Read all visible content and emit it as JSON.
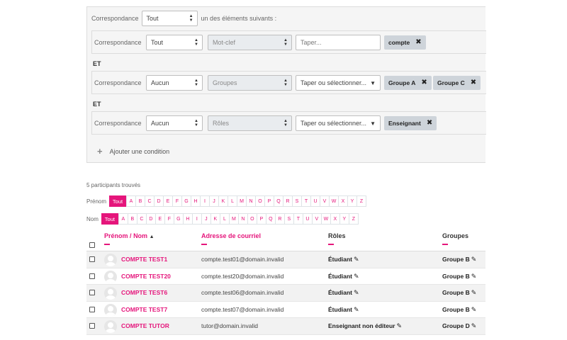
{
  "filters": {
    "match_label": "Correspondance",
    "match_value": "Tout",
    "match_suffix": "un des éléments suivants :",
    "conditions": [
      {
        "match_label": "Correspondance",
        "match_value": "Tout",
        "type": "Mot-clef",
        "input_placeholder": "Taper...",
        "tags": [
          "compte"
        ]
      },
      {
        "join": "ET",
        "match_label": "Correspondance",
        "match_value": "Aucun",
        "type": "Groupes",
        "input_placeholder": "Taper ou sélectionner...",
        "tags": [
          "Groupe A",
          "Groupe C"
        ]
      },
      {
        "join": "ET",
        "match_label": "Correspondance",
        "match_value": "Aucun",
        "type": "Rôles",
        "input_placeholder": "Taper ou sélectionner...",
        "tags": [
          "Enseignant"
        ]
      }
    ],
    "add_condition": "Ajouter une condition"
  },
  "participants": {
    "count_text": "5 participants trouvés",
    "firstname_label": "Prénom",
    "lastname_label": "Nom",
    "all_label": "Tout",
    "letters": [
      "A",
      "B",
      "C",
      "D",
      "E",
      "F",
      "G",
      "H",
      "I",
      "J",
      "K",
      "L",
      "M",
      "N",
      "O",
      "P",
      "Q",
      "R",
      "S",
      "T",
      "U",
      "V",
      "W",
      "X",
      "Y",
      "Z"
    ],
    "columns": {
      "firstname": "Prénom",
      "sep": "/",
      "lastname": "Nom",
      "email": "Adresse de courriel",
      "roles": "Rôles",
      "groups": "Groupes"
    },
    "rows": [
      {
        "name": "COMPTE TEST1",
        "email": "compte.test01@domain.invalid",
        "role": "Étudiant",
        "group": "Groupe B"
      },
      {
        "name": "COMPTE TEST20",
        "email": "compte.test20@domain.invalid",
        "role": "Étudiant",
        "group": "Groupe B"
      },
      {
        "name": "COMPTE TEST6",
        "email": "compte.test06@domain.invalid",
        "role": "Étudiant",
        "group": "Groupe B"
      },
      {
        "name": "COMPTE TEST7",
        "email": "compte.test07@domain.invalid",
        "role": "Étudiant",
        "group": "Groupe B"
      },
      {
        "name": "COMPTE TUTOR",
        "email": "tutor@domain.invalid",
        "role": "Enseignant non éditeur",
        "group": "Groupe D"
      }
    ]
  },
  "colors": {
    "accent": "#e5157b",
    "tag_bg": "#ced4da",
    "panel_bg": "#f5f5f5"
  },
  "icons": {
    "edit": "pencil-icon",
    "remove": "close-icon",
    "add": "plus-icon",
    "sort": "sort-asc-icon"
  }
}
